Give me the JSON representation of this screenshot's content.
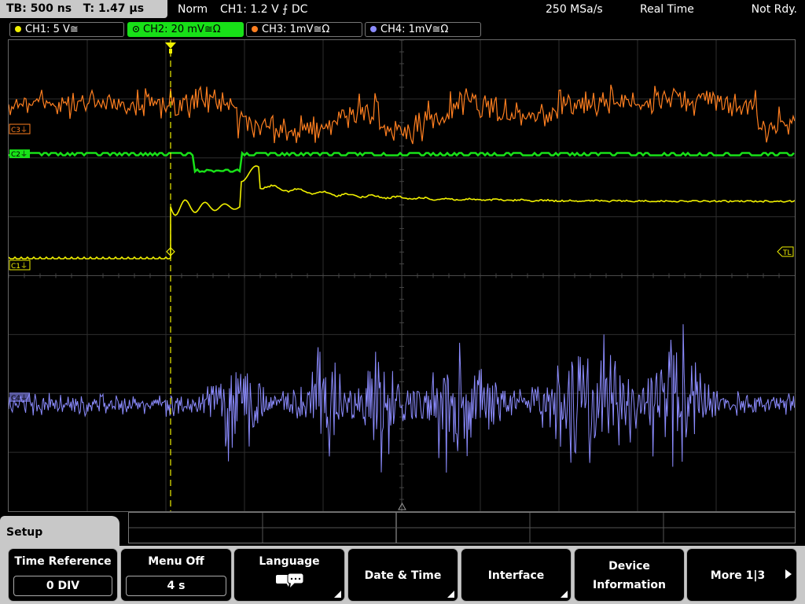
{
  "topbar": {
    "timebase": "TB: 500 ns",
    "trigger_time": "T: 1.47 µs",
    "mode": "Norm",
    "trigger_info": "CH1: 1.2 V ⨍ DC",
    "sample_rate": "250 MSa/s",
    "acq_mode": "Real Time",
    "status": "Not Rdy."
  },
  "channels": [
    {
      "label": "CH1: 5 V≅",
      "color": "#f0f000",
      "active": false
    },
    {
      "label": "CH2: 20 mV≅Ω",
      "color": "#18e018",
      "active": true
    },
    {
      "label": "CH3: 1mV≅Ω",
      "color": "#ff7f20",
      "active": false
    },
    {
      "label": "CH4: 1mV≅Ω",
      "color": "#8c8cff",
      "active": false
    }
  ],
  "markers": {
    "c3": "C3⏚",
    "c2": "C2⏚",
    "c1": "C1⏚",
    "c4": "C4⏚",
    "trigger_level": "TL"
  },
  "menu": {
    "title": "Setup",
    "buttons": [
      {
        "label": "Time Reference",
        "value": "0 DIV"
      },
      {
        "label": "Menu Off",
        "value": "4 s"
      },
      {
        "label": "Language",
        "icon": "speech-bubbles-icon"
      },
      {
        "label": "Date & Time"
      },
      {
        "label": "Interface"
      },
      {
        "label": "Device",
        "label2": "Information"
      },
      {
        "label": "More 1|3"
      }
    ]
  }
}
